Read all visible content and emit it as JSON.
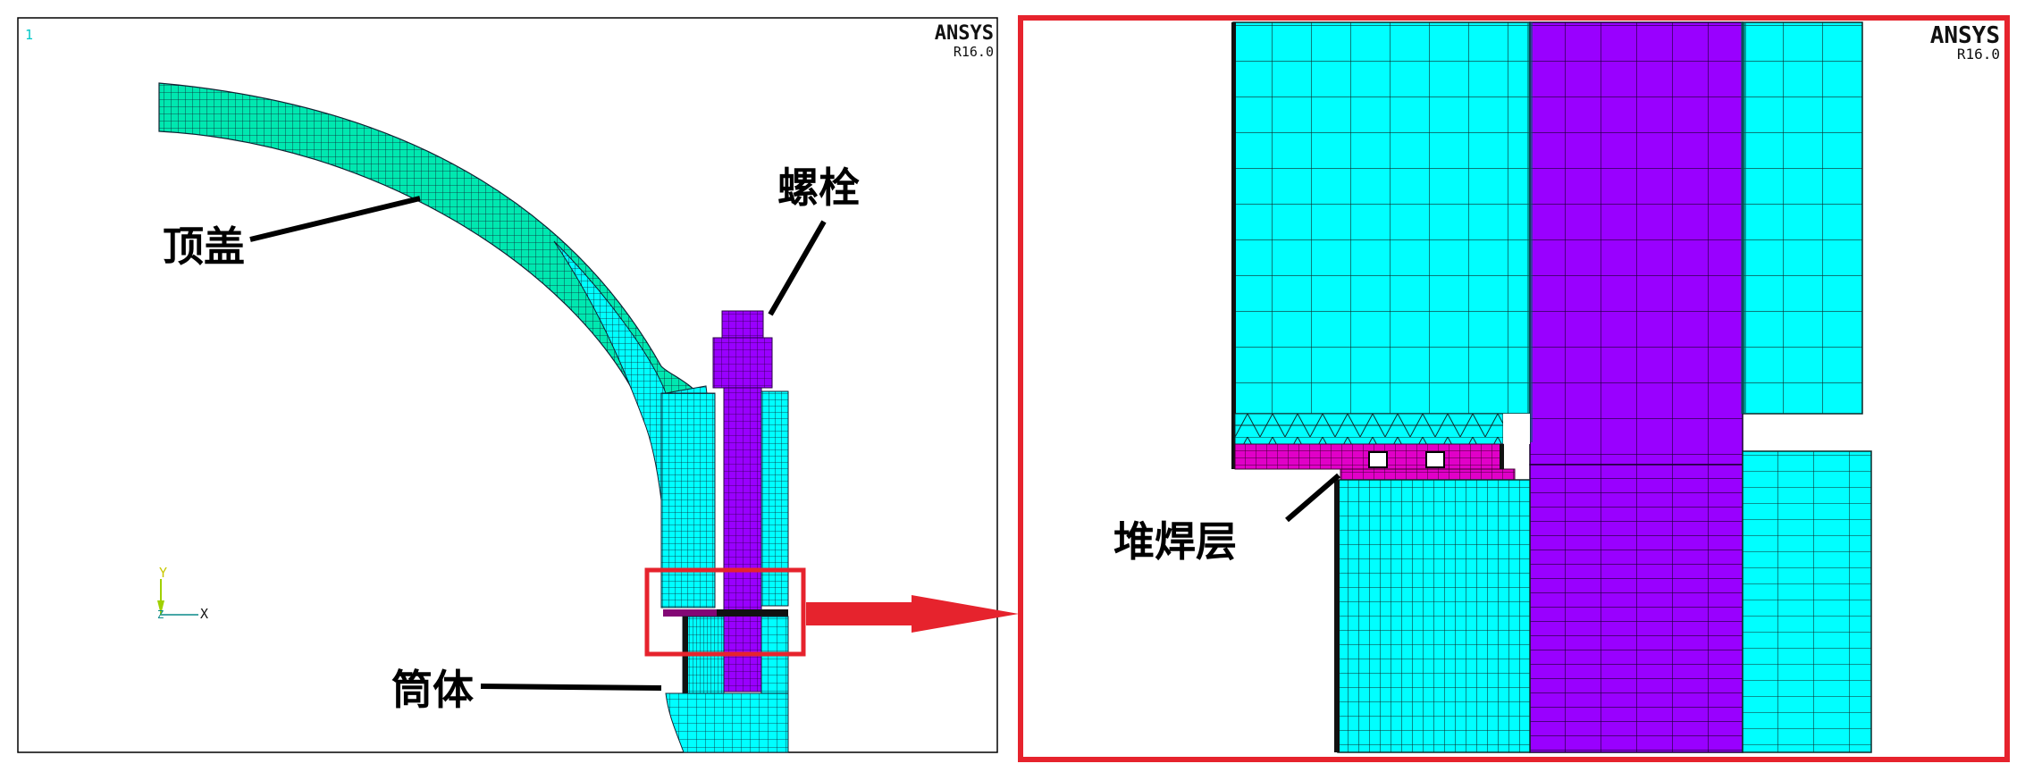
{
  "left_view": {
    "brand": "ANSYS",
    "release": "R16.0",
    "window_number": "1",
    "axis_y": "Y",
    "axis_x": "X",
    "axis_z": "Z"
  },
  "right_view": {
    "brand": "ANSYS",
    "release": "R16.0"
  },
  "labels": {
    "top_cover": "顶盖",
    "bolt": "螺栓",
    "shell": "筒体",
    "overlay_layer": "堆焊层"
  },
  "colors": {
    "cyan": "#00ffff",
    "cyan_dark": "#00c8c8",
    "green_mesh": "#00e6a0",
    "purple": "#9900ff",
    "magenta": "#e100c8",
    "red_frame": "#e6232d",
    "mesh_line": "#0f2a2a"
  }
}
